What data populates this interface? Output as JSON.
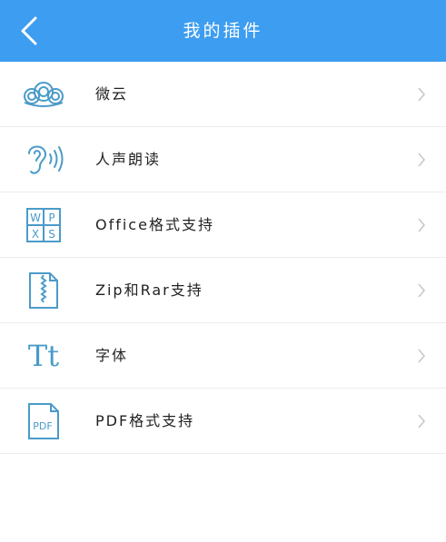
{
  "header": {
    "title": "我的插件",
    "back_icon": "chevron-left-icon",
    "bg_color": "#3d9df0"
  },
  "plugins": [
    {
      "label": "微云",
      "icon": "cloud-icon"
    },
    {
      "label": "人声朗读",
      "icon": "ear-sound-icon"
    },
    {
      "label": "Office格式支持",
      "icon": "wpxs-grid-icon"
    },
    {
      "label": "Zip和Rar支持",
      "icon": "zip-file-icon"
    },
    {
      "label": "字体",
      "icon": "font-tt-icon"
    },
    {
      "label": "PDF格式支持",
      "icon": "pdf-file-icon"
    }
  ],
  "icon_color": "#4a9bc9",
  "font_icon_text": "Tt",
  "office_icon_letters": [
    "W",
    "P",
    "X",
    "S"
  ],
  "pdf_icon_text": "PDF"
}
